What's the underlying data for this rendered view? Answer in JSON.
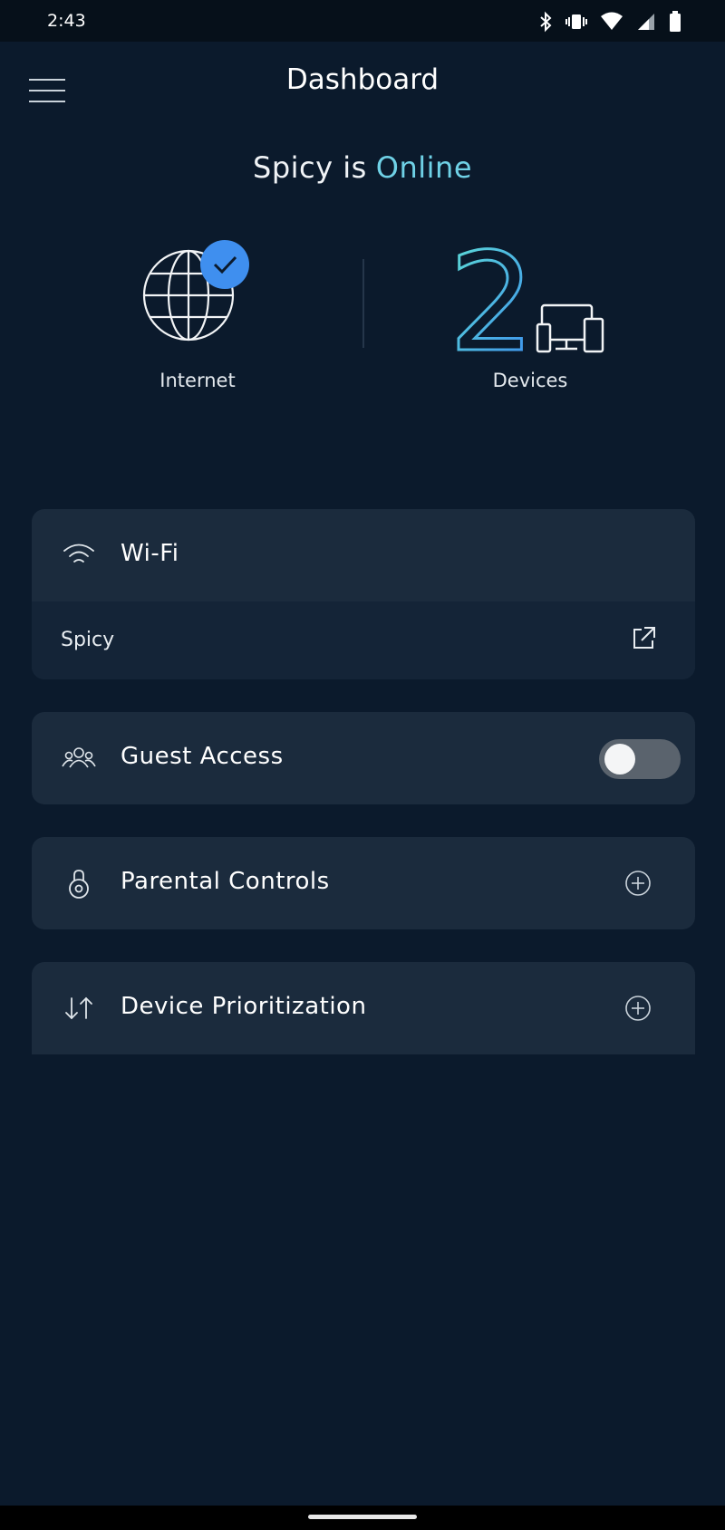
{
  "status_bar": {
    "time": "2:43",
    "icons": [
      "bluetooth-icon",
      "vibrate-icon",
      "wifi-signal-icon",
      "cell-signal-icon",
      "battery-icon"
    ]
  },
  "header": {
    "title": "Dashboard",
    "menu_icon": "hamburger-menu-icon"
  },
  "network_status": {
    "prefix": "Spicy is",
    "state": "Online",
    "state_color": "#6fd1e6"
  },
  "summary": {
    "internet": {
      "label": "Internet",
      "icon": "globe-check-icon"
    },
    "devices": {
      "count": "2",
      "label": "Devices",
      "icon": "devices-icon"
    }
  },
  "cards": {
    "wifi": {
      "label": "Wi-Fi",
      "icon": "wifi-icon",
      "network_name": "Spicy",
      "action_icon": "external-link-icon"
    },
    "guest_access": {
      "label": "Guest Access",
      "icon": "people-icon",
      "enabled": false
    },
    "parental_controls": {
      "label": "Parental Controls",
      "icon": "lock-icon",
      "action_icon": "plus-circle-icon"
    },
    "device_prioritization": {
      "label": "Device Prioritization",
      "icon": "up-down-arrows-icon",
      "action_icon": "plus-circle-icon"
    }
  },
  "colors": {
    "background": "#0b1a2c",
    "card": "#1b2b3d",
    "accent": "#6fd1e6",
    "badge": "#3f8fef"
  }
}
